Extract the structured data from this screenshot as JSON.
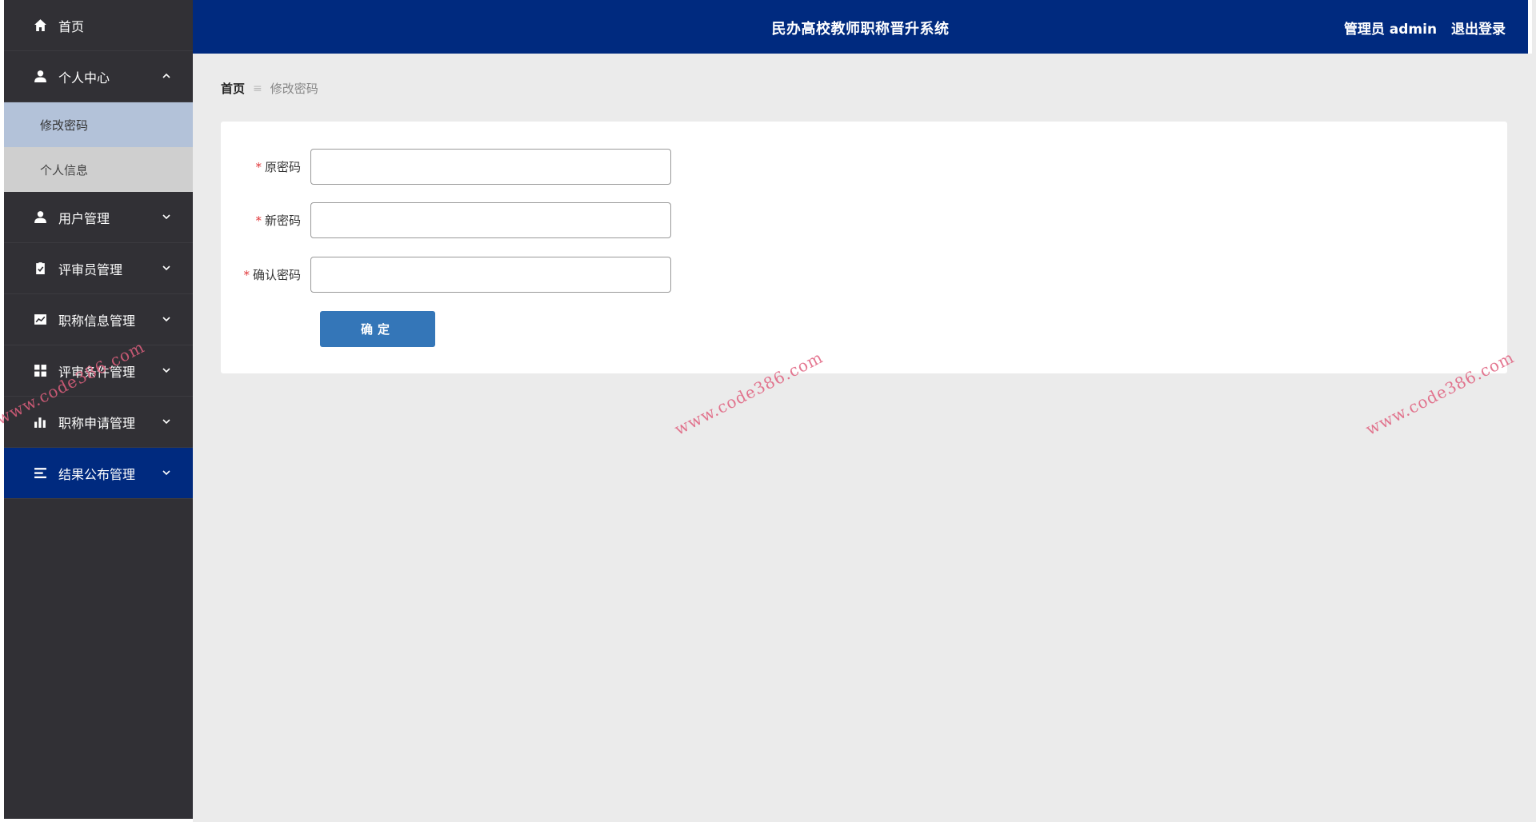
{
  "header": {
    "title": "民办高校教师职称晋升系统",
    "user": "管理员 admin",
    "logout": "退出登录"
  },
  "sidebar": {
    "items": [
      {
        "label": "首页",
        "icon": "home-icon"
      },
      {
        "label": "个人中心",
        "icon": "user-icon",
        "expanded": true,
        "children": [
          {
            "label": "修改密码",
            "active": true
          },
          {
            "label": "个人信息"
          }
        ]
      },
      {
        "label": "用户管理",
        "icon": "user-icon"
      },
      {
        "label": "评审员管理",
        "icon": "clipboard-icon"
      },
      {
        "label": "职称信息管理",
        "icon": "chart-line-icon"
      },
      {
        "label": "评审条件管理",
        "icon": "grid-icon"
      },
      {
        "label": "职称申请管理",
        "icon": "bar-chart-icon"
      },
      {
        "label": "结果公布管理",
        "icon": "list-icon",
        "active": true
      }
    ]
  },
  "breadcrumb": {
    "home": "首页",
    "separator": "≡",
    "current": "修改密码"
  },
  "form": {
    "old_password": {
      "label": "原密码",
      "value": ""
    },
    "new_password": {
      "label": "新密码",
      "value": ""
    },
    "confirm_password": {
      "label": "确认密码",
      "value": ""
    },
    "required_mark": "*",
    "submit_label": "确定"
  },
  "watermark": "www.code386.com",
  "colors": {
    "header_bg": "#002a7f",
    "sidebar_bg": "#313035",
    "button_bg": "#3476b8",
    "required": "#e0373a",
    "watermark": "#e0607e"
  }
}
